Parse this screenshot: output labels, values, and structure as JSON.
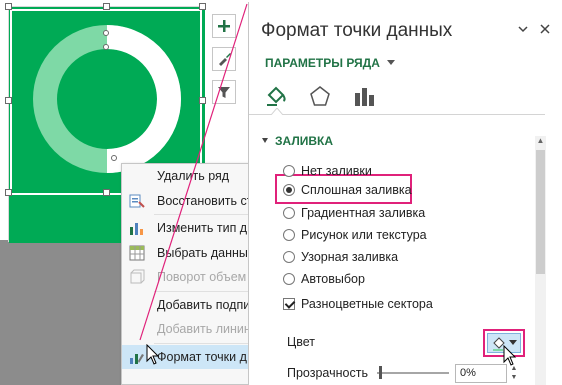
{
  "context_menu": {
    "items": [
      {
        "label": "Удалить ряд",
        "disabled": false,
        "icon": "none"
      },
      {
        "label": "Восстановить ст",
        "disabled": false,
        "icon": "reset-style-icon"
      },
      {
        "label": "Изменить тип ди",
        "disabled": false,
        "icon": "chart-type-icon"
      },
      {
        "label": "Выбрать данные",
        "disabled": false,
        "icon": "select-data-icon"
      },
      {
        "label": "Поворот объем",
        "disabled": true,
        "icon": "rotation-3d-icon"
      },
      {
        "label": "Добавить подпи",
        "disabled": false,
        "icon": "none"
      },
      {
        "label": "Добавить линин",
        "disabled": true,
        "icon": "none"
      },
      {
        "label": "Формат точки д",
        "disabled": false,
        "icon": "format-point-icon",
        "highlighted": true
      }
    ]
  },
  "pane": {
    "title": "Формат точки данных",
    "series_options": "ПАРАМЕТРЫ РЯДА",
    "section": "ЗАЛИВКА",
    "fill_options": [
      {
        "label": "Нет заливки",
        "selected": false
      },
      {
        "label": "Сплошная заливка",
        "selected": true
      },
      {
        "label": "Градиентная заливка",
        "selected": false
      },
      {
        "label": "Рисунок или текстура",
        "selected": false
      },
      {
        "label": "Узорная заливка",
        "selected": false
      },
      {
        "label": "Автовыбор",
        "selected": false
      }
    ],
    "vary_colors": {
      "label": "Разноцветные сектора",
      "checked": true
    },
    "color_label": "Цвет",
    "transparency_label": "Прозрачность",
    "transparency_value": "0%",
    "transparency_fraction": 0
  },
  "colors": {
    "chart_bg": "#00aa55",
    "ring_light": "#7ed9a6",
    "accent_green": "#217346",
    "highlight_pink": "#e0217a",
    "menu_highlight": "#cde6f7"
  }
}
